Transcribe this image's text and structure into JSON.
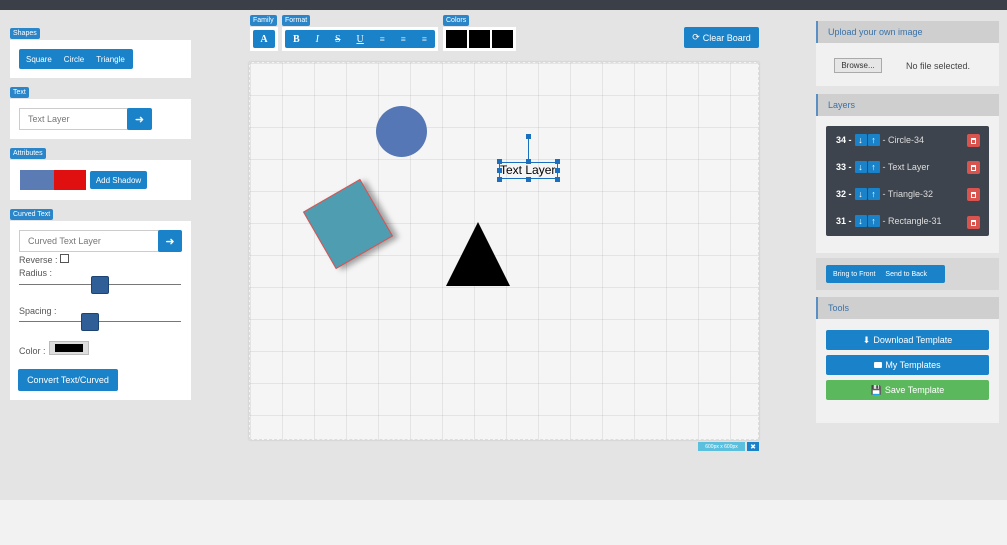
{
  "left": {
    "shapes": {
      "label": "Shapes",
      "buttons": [
        "Square",
        "Circle",
        "Triangle"
      ]
    },
    "text": {
      "label": "Text",
      "placeholder": "Text Layer"
    },
    "attributes": {
      "label": "Attributes",
      "shadow_button": "Add Shadow"
    },
    "curved": {
      "label": "Curved Text",
      "placeholder": "Curved Text Layer",
      "reverse": "Reverse :",
      "radius": "Radius :",
      "spacing": "Spacing :",
      "color": "Color :",
      "convert": "Convert Text/Curved"
    }
  },
  "toolbar": {
    "family": {
      "label": "Family",
      "button": "A"
    },
    "format": {
      "label": "Format",
      "bold": "B",
      "italic": "I",
      "strike": "S",
      "underline": "U"
    },
    "colors": {
      "label": "Colors"
    },
    "clear": "Clear Board"
  },
  "canvas": {
    "text_layer": "Text Layer",
    "size_badge": "600px x 600px"
  },
  "right": {
    "upload": {
      "title": "Upload your own image",
      "browse": "Browse...",
      "file_status": "No file selected."
    },
    "layers": {
      "title": "Layers",
      "items": [
        {
          "num": "34 -",
          "name": "- Circle-34"
        },
        {
          "num": "33 -",
          "name": "- Text Layer"
        },
        {
          "num": "32 -",
          "name": "- Triangle-32"
        },
        {
          "num": "31 -",
          "name": "- Rectangle-31"
        }
      ]
    },
    "order": {
      "front": "Bring to Front",
      "back": "Send to Back"
    },
    "tools": {
      "title": "Tools",
      "download": "Download Template",
      "my": "My Templates",
      "save": "Save Template"
    }
  },
  "colors": {
    "accent": "#1a82c8",
    "shape_circle": "#5577b5",
    "shape_square": "#4e9db0",
    "swatch_blue": "#5b7bb5",
    "swatch_red": "#e01010",
    "success": "#5cb85c",
    "danger": "#d9534f"
  }
}
